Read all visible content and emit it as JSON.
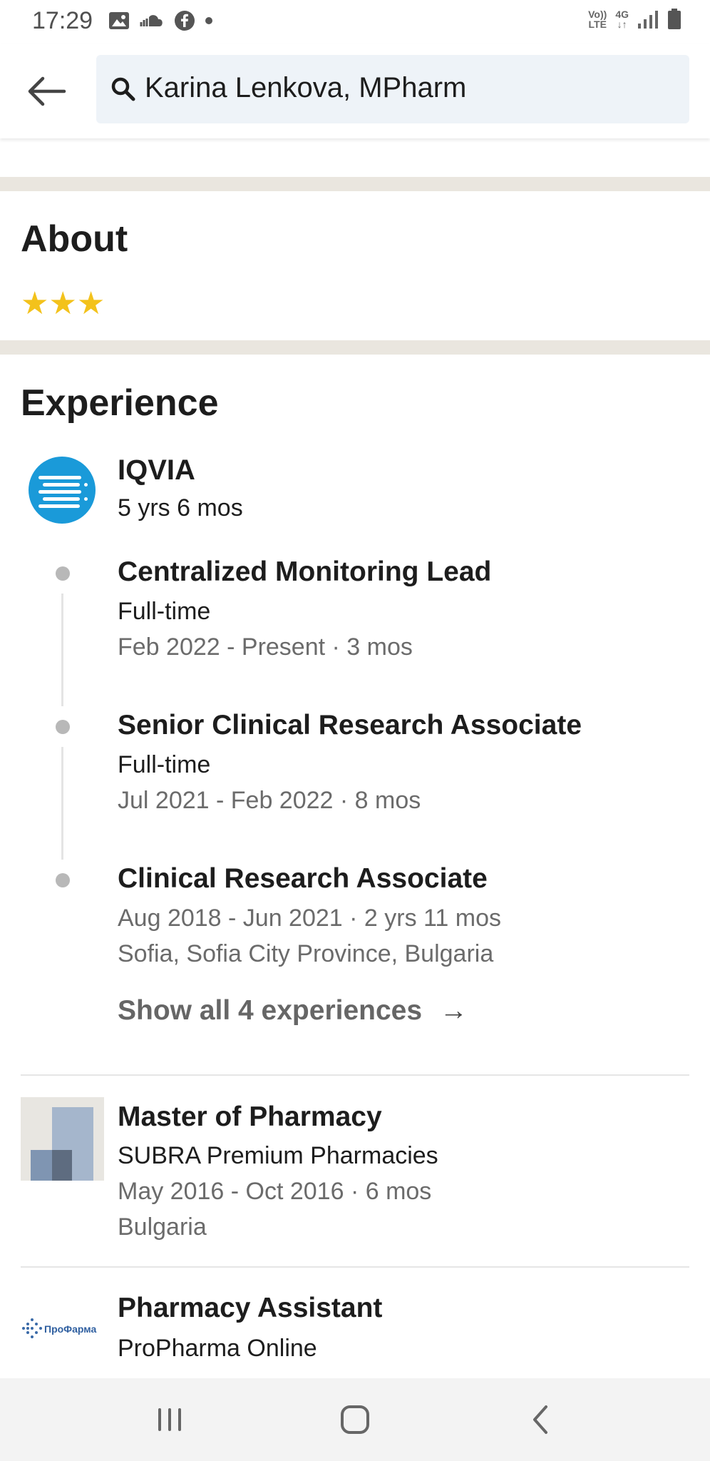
{
  "status_bar": {
    "time": "17:29",
    "left_icons": [
      "image-icon",
      "soundcloud-icon",
      "facebook-icon",
      "dot-icon"
    ],
    "network_label_1": "Vo))",
    "network_label_2": "LTE",
    "network_type": "4G",
    "right_icons": [
      "volte-icon",
      "4g-icon",
      "signal-icon",
      "battery-icon"
    ]
  },
  "header": {
    "search_value": "Karina Lenkova, MPharm"
  },
  "about": {
    "title": "About",
    "stars": "★★★"
  },
  "experience": {
    "title": "Experience",
    "company": {
      "name": "IQVIA",
      "duration": "5 yrs 6 mos",
      "roles": [
        {
          "title": "Centralized Monitoring Lead",
          "type": "Full-time",
          "dates": "Feb 2022 - Present · 3 mos"
        },
        {
          "title": "Senior Clinical Research Associate",
          "type": "Full-time",
          "dates": "Jul 2021 - Feb 2022 · 8 mos"
        },
        {
          "title": "Clinical Research Associate",
          "dates": "Aug 2018 - Jun 2021 · 2 yrs 11 mos",
          "location": "Sofia, Sofia City Province, Bulgaria"
        }
      ]
    },
    "show_all": "Show all 4 experiences",
    "arrow": "→",
    "other_positions": [
      {
        "title": "Master of Pharmacy",
        "company": "SUBRA Premium Pharmacies",
        "dates": "May 2016 - Oct 2016 · 6 mos",
        "location": "Bulgaria"
      },
      {
        "title": "Pharmacy Assistant",
        "company": "ProPharma Online",
        "logo_text": "ПроФарма"
      }
    ]
  },
  "nav_bar": {
    "buttons": [
      "recent-apps-icon",
      "home-icon",
      "back-icon"
    ]
  },
  "colors": {
    "iqvia_blue": "#1a9ad9",
    "divider": "#eae6df",
    "search_bg": "#eef3f8",
    "star": "#f3c21b"
  }
}
